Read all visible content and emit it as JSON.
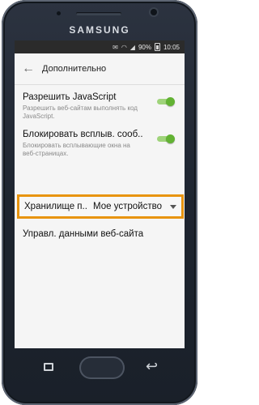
{
  "device": {
    "brand": "SAMSUNG"
  },
  "status_bar": {
    "battery": "90%",
    "time": "10:05"
  },
  "toolbar": {
    "title": "Дополнительно"
  },
  "settings": {
    "javascript": {
      "title": "Разрешить JavaScript",
      "subtitle": "Разрешить веб-сайтам выполнять код JavaScript.",
      "enabled": true
    },
    "popups": {
      "title": "Блокировать всплыв. сооб..",
      "subtitle": "Блокировать всплывающие окна на веб-страницах.",
      "enabled": true
    },
    "storage": {
      "label": "Хранилище п..",
      "value": "Мое устройство"
    },
    "manage_data": {
      "title": "Управл. данными веб-сайта"
    }
  },
  "colors": {
    "highlight": "#e8940f",
    "toggle_on": "#62b233"
  }
}
